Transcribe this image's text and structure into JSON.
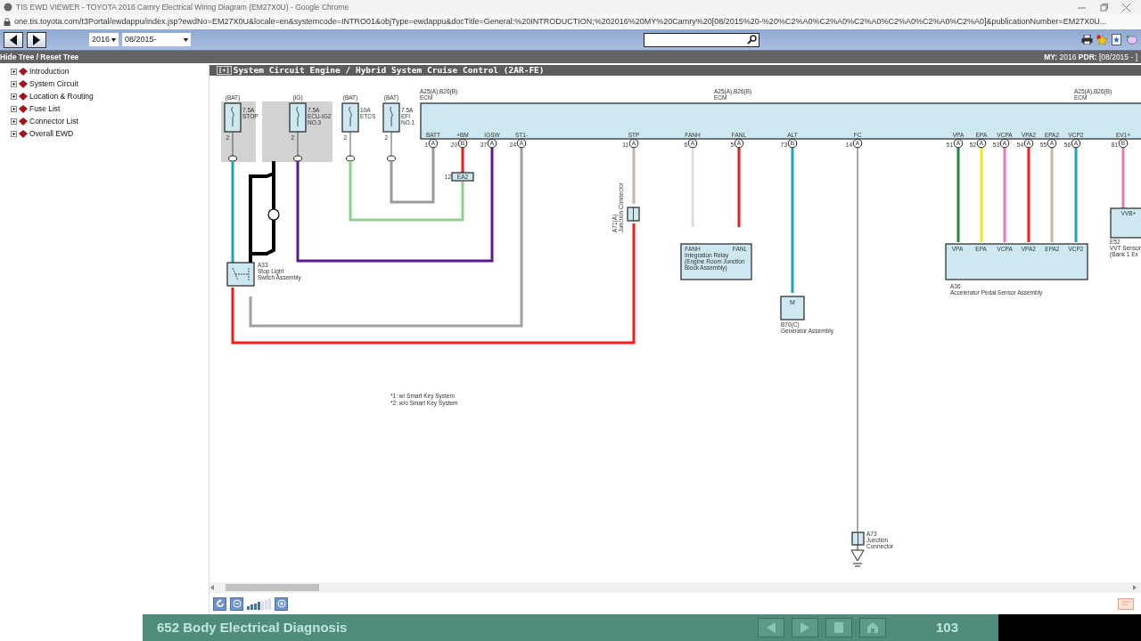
{
  "browser": {
    "title": "TIS EWD VIEWER - TOYOTA 2016 Camry Electrical Wiring Diagram (EM27X0U) - Google Chrome",
    "url": "one.tis.toyota.com/t3Portal/ewdappu/index.jsp?ewdNo=EM27X0U&locale=en&systemcode=INTRO01&objType=ewdappu&docTitle=General:%20INTRODUCTION;%202016%20MY%20Camry%20[08/2015%20-%20%C2%A0%C2%A0%C2%A0%C2%A0%C2%A0%C2%A0]&publicationNumber=EM27X0U..."
  },
  "toolbar": {
    "year": "2016",
    "date": "08/2015-"
  },
  "tree_bar": {
    "toggle": "Hide Tree / Reset Tree",
    "info": "**MY:** 2016 **PDR:** [08/2015 - ]"
  },
  "tree": [
    {
      "label": "Introduction"
    },
    {
      "label": "System Circuit"
    },
    {
      "label": "Location & Routing"
    },
    {
      "label": "Fuse List"
    },
    {
      "label": "Connector List"
    },
    {
      "label": "Overall EWD"
    }
  ],
  "diagram": {
    "expander": "[+]",
    "title": "System Circuit  Engine / Hybrid System  Cruise Control (2AR-FE)",
    "fuses": [
      {
        "power": "(BAT)",
        "rating": "7.5A",
        "lines": [
          "STOP"
        ],
        "pin": "2",
        "block": true
      },
      {
        "power": "(IG)",
        "rating": "7.5A",
        "lines": [
          "ECU-IG2",
          "NO.3"
        ],
        "pin": "2",
        "block": true
      },
      {
        "power": "(BAT)",
        "rating": "10A",
        "lines": [
          "ETCS"
        ],
        "pin": "2",
        "block": false
      },
      {
        "power": "(BAT)",
        "rating": "7.5A",
        "lines": [
          "EFI",
          "NO.1"
        ],
        "pin": "2",
        "block": false
      }
    ],
    "ecm_captions": [
      [
        "A25(A),B26(B)",
        "ECM"
      ],
      [
        "A25(A),B26(B)",
        "ECM"
      ],
      [
        "A25(A),B26(B)",
        "ECM"
      ]
    ],
    "ecm_pins": [
      {
        "name": "BATT",
        "num": "1",
        "conn": "A",
        "color": "#9a9a9a"
      },
      {
        "name": "+BM",
        "num": "20",
        "conn": "B",
        "color": "#ee1c1c"
      },
      {
        "name": "IGSW",
        "num": "37",
        "conn": "A",
        "color": "#5b1a8c"
      },
      {
        "name": "ST1-",
        "num": "24",
        "conn": "A",
        "color": "#a0a0a0"
      },
      {
        "name": "STP",
        "num": "11",
        "conn": "A",
        "color": "#c8b4a0"
      },
      {
        "name": "FANH",
        "num": "6",
        "conn": "A",
        "color": "#dcdcdc"
      },
      {
        "name": "FANL",
        "num": "5",
        "conn": "A",
        "color": "#ee1c1c"
      },
      {
        "name": "ALT",
        "num": "73",
        "conn": "B",
        "color": "#1ca3c4"
      },
      {
        "name": "FC",
        "num": "14",
        "conn": "A",
        "color": "#a8a8a8"
      },
      {
        "name": "VPA",
        "num": "51",
        "conn": "A",
        "color": "#1f8a3c"
      },
      {
        "name": "EPA",
        "num": "52",
        "conn": "A",
        "color": "#f2e51c"
      },
      {
        "name": "VCPA",
        "num": "53",
        "conn": "A",
        "color": "#e878b8"
      },
      {
        "name": "VPA2",
        "num": "54",
        "conn": "A",
        "color": "#ee1c1c"
      },
      {
        "name": "EPA2",
        "num": "55",
        "conn": "A",
        "color": "#c8b4a0"
      },
      {
        "name": "VCP2",
        "num": "56",
        "conn": "A",
        "color": "#1ca3c4"
      },
      {
        "name": "EV1+",
        "num": "81",
        "conn": "B",
        "color": "#e878b8"
      }
    ],
    "components": [
      {
        "kind": "switch",
        "lines": [
          "A33",
          "Stop Light",
          "Switch Assembly"
        ]
      },
      {
        "kind": "inline",
        "symbol": "EA2",
        "lines": [
          "12"
        ]
      },
      {
        "kind": "junction",
        "lines": [
          "A71(A)",
          "Junction Connector"
        ]
      },
      {
        "kind": "box",
        "pins": [
          "FANH",
          "FANL"
        ],
        "lines": [
          "Integration Relay",
          "(Engine Room Junction",
          "Block Assembly)"
        ]
      },
      {
        "kind": "box",
        "symbol": "M",
        "lines": [
          "B70(C)",
          "Generator Assembly"
        ]
      },
      {
        "kind": "box",
        "pins": [
          "VPA",
          "EPA",
          "VCPA",
          "VPA2",
          "EPA2",
          "VCP2"
        ],
        "lines": [
          "A36",
          "Accelerator Pedal Sensor Assembly"
        ]
      },
      {
        "kind": "box",
        "pins": [
          "VVB+"
        ],
        "lines": [
          "E52",
          "VVT Sensor",
          "(Bank 1 Ex"
        ]
      },
      {
        "kind": "junction",
        "lines": [
          "A73",
          "Junction",
          "Connector"
        ]
      }
    ],
    "footnotes": [
      "*1: w/ Smart Key System",
      "*2: w/o Smart Key System"
    ]
  },
  "zoom": {
    "level": 0.57
  },
  "banner": {
    "title": "652 Body Electrical Diagnosis",
    "page": "103"
  }
}
